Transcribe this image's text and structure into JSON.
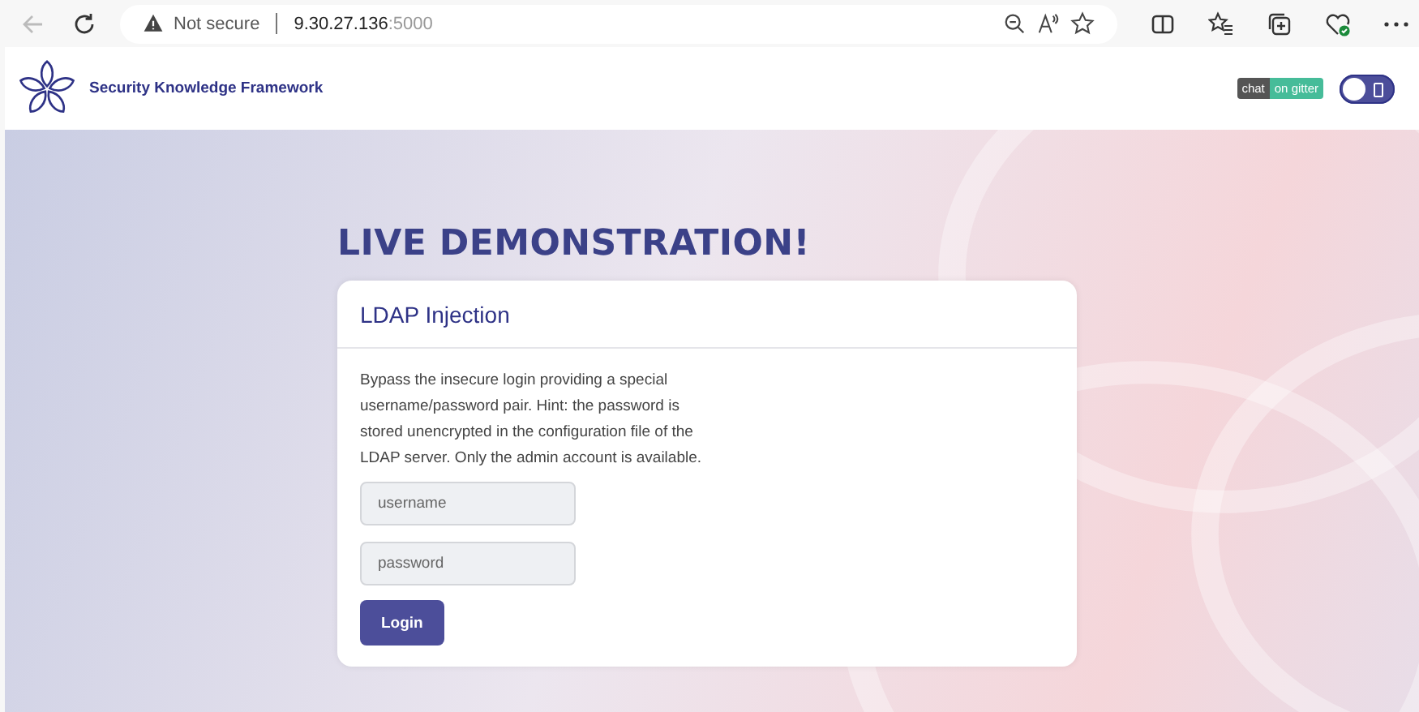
{
  "browser": {
    "security_label": "Not secure",
    "address_host": "9.30.27.136",
    "address_port": ":5000"
  },
  "header": {
    "title": "Security Knowledge Framework",
    "chat_badge": {
      "left": "chat",
      "right": "on gitter"
    },
    "theme_toggle": {
      "on": false
    }
  },
  "heading": "LIVE DEMONSTRATION!",
  "card": {
    "title": "LDAP Injection",
    "description": "Bypass the insecure login providing a special username/password pair. Hint: the password is stored unencrypted in the configuration file of the LDAP server. Only the admin account is available.",
    "fields": [
      {
        "placeholder": "username"
      },
      {
        "placeholder": "password"
      }
    ],
    "button": "Login"
  }
}
